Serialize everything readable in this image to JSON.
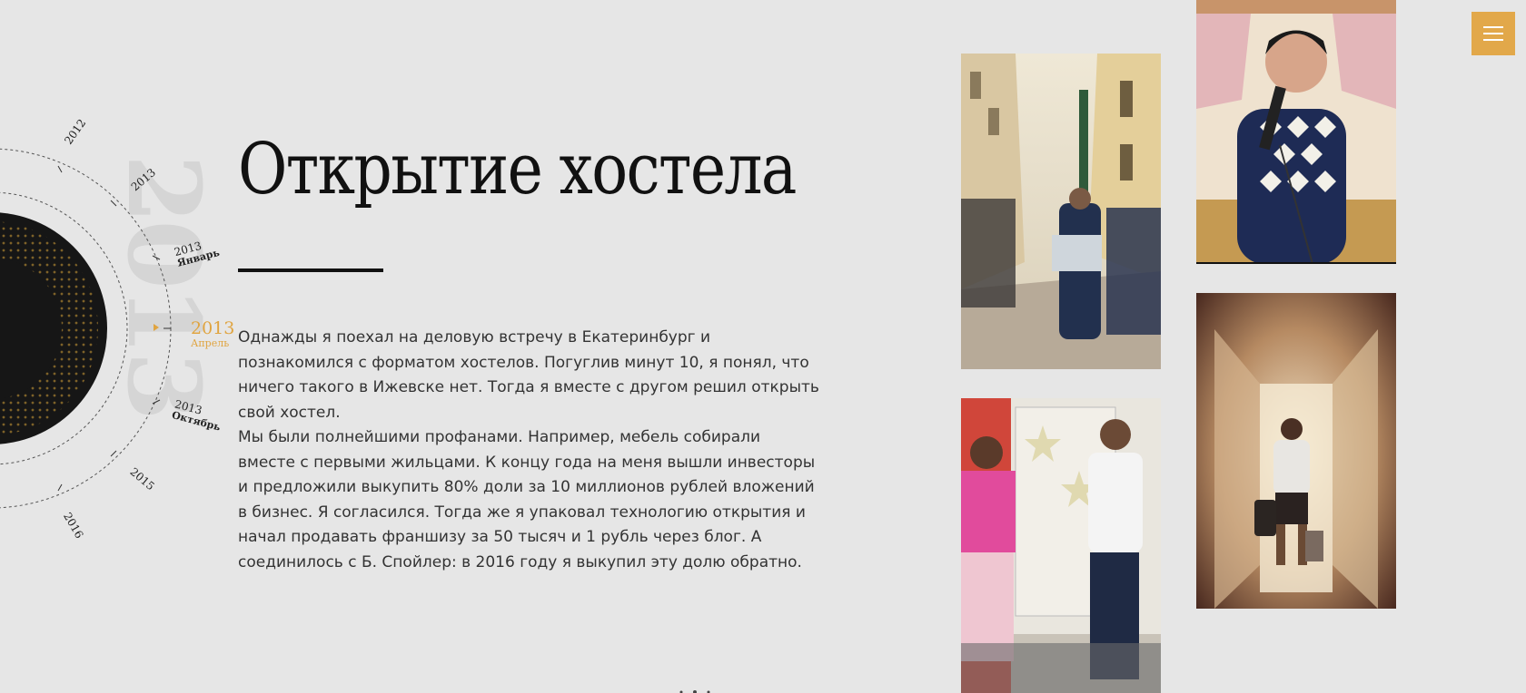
{
  "timeline": {
    "big_year": "2013",
    "labels": [
      {
        "year": "2012",
        "sub": ""
      },
      {
        "year": "2013",
        "sub": ""
      },
      {
        "year": "2013",
        "sub": "Январь"
      },
      {
        "year": "2013",
        "sub": "Апрель"
      },
      {
        "year": "2013",
        "sub": "Октябрь"
      },
      {
        "year": "2015",
        "sub": ""
      },
      {
        "year": "2016",
        "sub": ""
      }
    ],
    "active_index": 3,
    "accent_color": "#e0a440"
  },
  "article": {
    "title": "Открытие хостела",
    "paragraph_1": "Однажды я поехал на деловую встречу в Екатеринбург и познакомился с форматом хостелов. Погуглив минут 10, я понял, что ничего такого в Ижевске нет. Тогда я вместе с другом решил открыть свой хостел.",
    "paragraph_2": "Мы были полнейшими профанами. Например, мебель собирали вместе с первыми жильцами. К концу года на меня вышли инвесторы и предложили выкупить 80% доли за 10 миллионов рублей вложений в бизнес. Я согласился. Тогда же я упаковал технологию открытия и начал продавать франшизу за 50 тысяч и 1 рубль через блог. А соединилось с Б. Спойлер: в 2016 году я выкупил эту долю обратно."
  },
  "photos": [
    {
      "name": "photo-street-map"
    },
    {
      "name": "photo-interview"
    },
    {
      "name": "photo-microphone"
    },
    {
      "name": "photo-hallway"
    }
  ],
  "menu": {
    "icon": "hamburger-icon",
    "color": "#e2a84a"
  }
}
